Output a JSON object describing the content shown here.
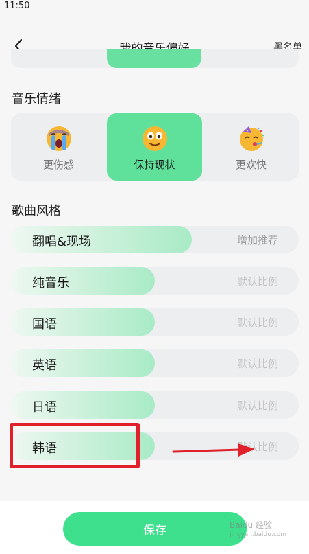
{
  "status_bar": {
    "time": "11:50"
  },
  "header": {
    "title": "我的音乐偏好",
    "right_action": "黑名单"
  },
  "mood": {
    "title": "音乐情绪",
    "options": [
      {
        "label": "更伤感",
        "icon": "crying-face-icon",
        "selected": false
      },
      {
        "label": "保持现状",
        "icon": "smiling-face-icon",
        "selected": true
      },
      {
        "label": "更欢快",
        "icon": "party-face-icon",
        "selected": false
      }
    ]
  },
  "genre": {
    "title": "歌曲风格",
    "items": [
      {
        "name": "翻唱&现场",
        "hint": "增加推荐",
        "level": 0.63
      },
      {
        "name": "纯音乐",
        "hint": "默认比例",
        "level": 0.5
      },
      {
        "name": "国语",
        "hint": "默认比例",
        "level": 0.5
      },
      {
        "name": "英语",
        "hint": "默认比例",
        "level": 0.5
      },
      {
        "name": "日语",
        "hint": "默认比例",
        "level": 0.5
      },
      {
        "name": "韩语",
        "hint": "默认比例",
        "level": 0.5
      }
    ]
  },
  "footer": {
    "save_label": "保存"
  },
  "watermark": {
    "text": "Baidu 经验",
    "sub": "jingyan.baidu.com"
  },
  "colors": {
    "accent": "#5fe19c",
    "save_button": "#3ee08d",
    "annotation": "#e0202a"
  }
}
